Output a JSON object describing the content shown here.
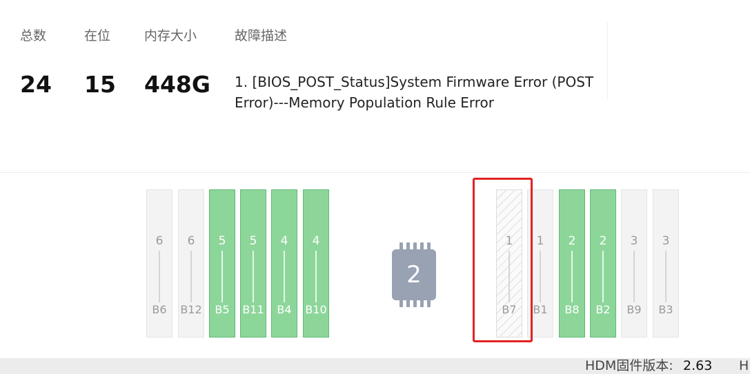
{
  "summary": {
    "labels": {
      "total": "总数",
      "present": "在位",
      "memory": "内存大小",
      "fault": "故障描述"
    },
    "values": {
      "total": "24",
      "present": "15",
      "memory": "448G"
    },
    "fault_description": "1. [BIOS_POST_Status]System Firmware Error (POST Error)---Memory Population Rule Error"
  },
  "cpu": {
    "label": "2"
  },
  "slots_left": [
    {
      "num": "6",
      "name": "B6",
      "state": "empty"
    },
    {
      "num": "6",
      "name": "B12",
      "state": "empty"
    },
    {
      "num": "5",
      "name": "B5",
      "state": "present"
    },
    {
      "num": "5",
      "name": "B11",
      "state": "present"
    },
    {
      "num": "4",
      "name": "B4",
      "state": "present"
    },
    {
      "num": "4",
      "name": "B10",
      "state": "present"
    }
  ],
  "slots_right": [
    {
      "num": "1",
      "name": "B7",
      "state": "faulty"
    },
    {
      "num": "1",
      "name": "B1",
      "state": "empty"
    },
    {
      "num": "2",
      "name": "B8",
      "state": "present"
    },
    {
      "num": "2",
      "name": "B2",
      "state": "present"
    },
    {
      "num": "3",
      "name": "B9",
      "state": "empty"
    },
    {
      "num": "3",
      "name": "B3",
      "state": "empty"
    }
  ],
  "footer": {
    "firmware_label": "HDM固件版本:",
    "firmware_version": "2.63",
    "truncated": "H"
  },
  "colors": {
    "present": "#8dd69a",
    "empty": "#f3f3f3",
    "highlight": "#e02222",
    "cpu": "#98a2b2"
  }
}
